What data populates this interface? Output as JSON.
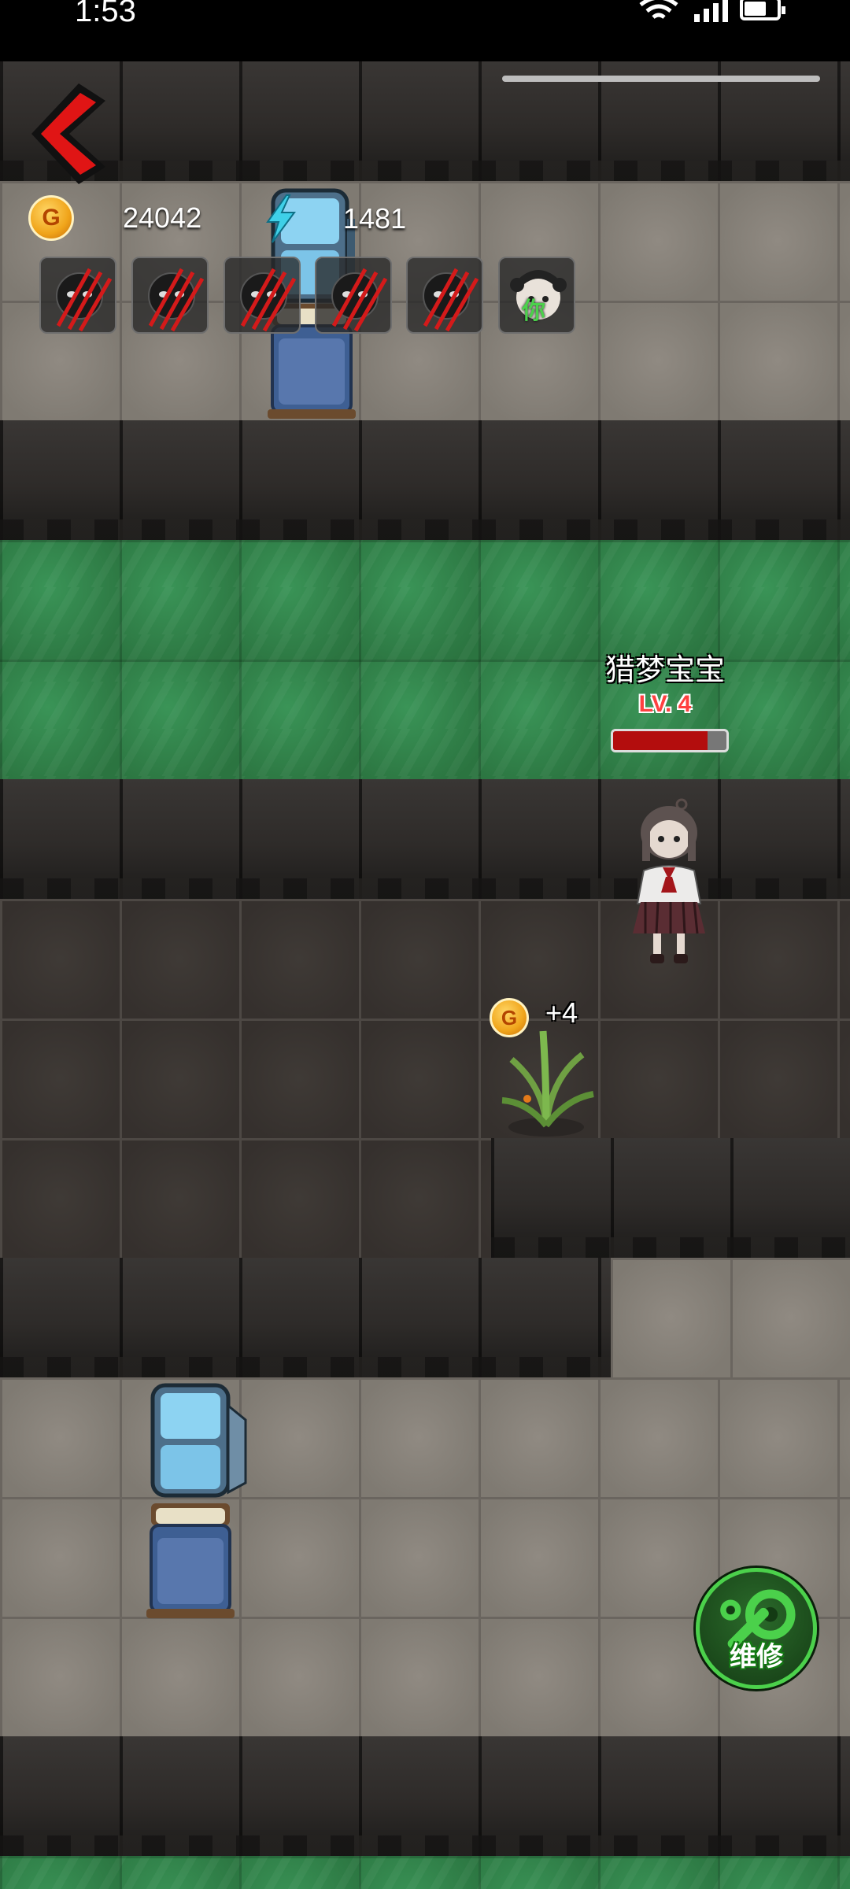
{
  "status_bar": {
    "time": "1:53"
  },
  "resources": {
    "gold": {
      "icon": "coin-icon",
      "symbol": "G",
      "value": "24042"
    },
    "energy": {
      "icon": "lightning-icon",
      "value": "1481"
    }
  },
  "skill_slots": [
    {
      "icon": "ghost-face-icon",
      "state": "scratched"
    },
    {
      "icon": "ghost-face-icon",
      "state": "scratched"
    },
    {
      "icon": "ghost-face-icon",
      "state": "scratched"
    },
    {
      "icon": "ghost-face-icon",
      "state": "scratched"
    },
    {
      "icon": "ghost-face-icon",
      "state": "scratched"
    },
    {
      "icon": "girl-face-icon",
      "label": "你"
    }
  ],
  "enemy": {
    "name": "猎梦宝宝",
    "level": "LV. 4",
    "hp_fraction": 0.83
  },
  "income": {
    "symbol": "G",
    "text": "+4"
  },
  "repair_button": {
    "label": "维修",
    "icon": "wrench-gear-icon"
  },
  "colors": {
    "grass": "#2f7d46",
    "hp": "#b30d0d",
    "repair_green": "#4bd14b",
    "back_red": "#e01515"
  }
}
